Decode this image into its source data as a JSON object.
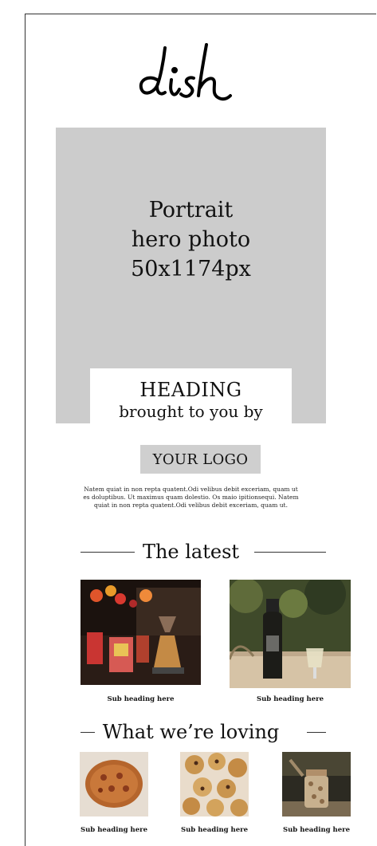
{
  "brand": {
    "logo_text": "dish"
  },
  "hero": {
    "placeholder_lines": [
      "Portrait",
      "hero photo",
      "50x1174px"
    ],
    "heading": "HEADING",
    "subheading": "brought to you by"
  },
  "sponsor": {
    "logo_text": "YOUR LOGO"
  },
  "intro": {
    "lines": [
      "Natem quiat in non repta quatent.Odi velibus debit exceriam, quam ut",
      "es doluptibus. Ut maximus quam dolestio. Os maio ipitionsequi. Natem",
      "quiat in non repta quatent.Odi velibus debit exceriam, quam ut."
    ]
  },
  "latest": {
    "title": "The latest",
    "items": [
      {
        "caption": "Sub heading here",
        "image": "coffee-bar-photo"
      },
      {
        "caption": "Sub heading here",
        "image": "wine-table-photo"
      }
    ]
  },
  "loving": {
    "title": "What we’re loving",
    "items": [
      {
        "caption": "Sub heading here",
        "image": "pizza-photo"
      },
      {
        "caption": "Sub heading here",
        "image": "cookies-photo"
      },
      {
        "caption": "Sub heading here",
        "image": "jar-photo"
      }
    ]
  },
  "colors": {
    "placeholder_gray": "#cccccc",
    "logo_box_gray": "#cfcfcf",
    "text": "#111111"
  }
}
